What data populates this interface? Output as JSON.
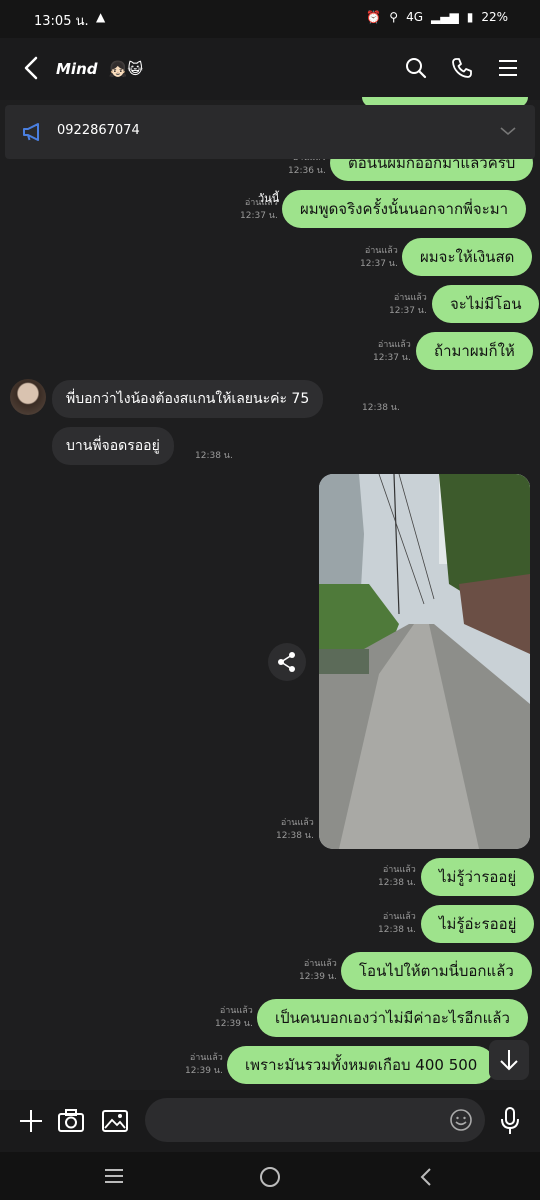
{
  "status_bar": {
    "time": "13:05 น.",
    "battery": "22%",
    "network": "4G"
  },
  "header": {
    "title": "Mind",
    "emoji": "👧🏻😺"
  },
  "pinned": {
    "text": "0922867074"
  },
  "messages": [
    {
      "text": "ตอนนี้ผมก็ออกมาแล้วครับ",
      "read": "อ่านแล้ว",
      "time": "12:36 น."
    },
    {
      "text": "ผมพูดจริงครั้งนั้นนอกจากพี่จะมา",
      "read": "อ่านแล้ว",
      "time": "12:37 น.",
      "overlay": "วันนี้"
    },
    {
      "text": "ผมจะให้เงินสด",
      "read": "อ่านแล้ว",
      "time": "12:37 น."
    },
    {
      "text": "จะไม่มีโอน",
      "read": "อ่านแล้ว",
      "time": "12:37 น."
    },
    {
      "text": "ถ้ามาผมก็ให้",
      "read": "อ่านแล้ว",
      "time": "12:37 น."
    },
    {
      "text": "พี่บอกว่าไงน้องต้องสแกนให้เลยนะค่ะ 75",
      "time": "12:38 น."
    },
    {
      "text": "บานพี่จอดรออยู่",
      "time": "12:38 น."
    },
    {
      "read": "อ่านแล้ว",
      "time": "12:38 น."
    },
    {
      "text": "ไม่รู้ว่ารออยู่",
      "read": "อ่านแล้ว",
      "time": "12:38 น."
    },
    {
      "text": "ไม่รู้อ่ะรออยู่",
      "read": "อ่านแล้ว",
      "time": "12:38 น."
    },
    {
      "text": "โอนไปให้ตามนี่บอกแล้ว",
      "read": "อ่านแล้ว",
      "time": "12:39 น."
    },
    {
      "text": "เป็นคนบอกเองว่าไม่มีค่าอะไรอีกแล้ว",
      "read": "อ่านแล้ว",
      "time": "12:39 น."
    },
    {
      "text": "เพราะมันรวมทั้งหมดเกือบ 400 500",
      "read": "อ่านแล้ว",
      "time": "12:39 น."
    }
  ],
  "colors": {
    "outgoing": "#9ee38c",
    "incoming": "#2e2e30",
    "background": "#1e1e1f"
  }
}
